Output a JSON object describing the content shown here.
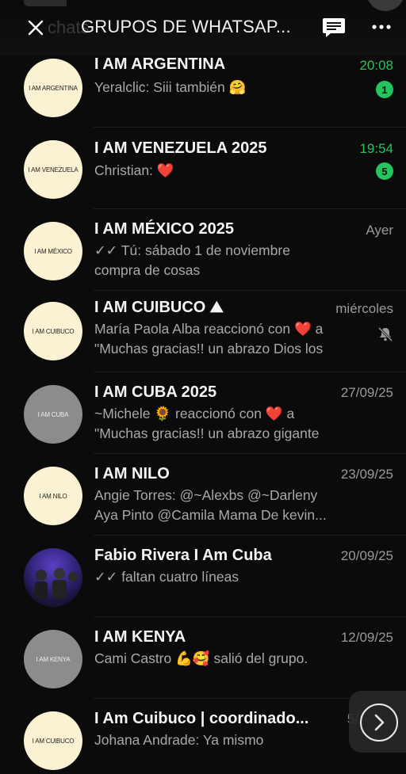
{
  "header": {
    "ghost_title": "chats",
    "title": "GRUPOS DE WHATSAP...",
    "close_icon": "close-icon",
    "compose_icon": "new-chat-icon",
    "more_icon": "more-icon"
  },
  "chats": [
    {
      "name": "I AM ARGENTINA",
      "avatar_text": "I AM ARGENTINA",
      "time": "20:08",
      "time_color": "green",
      "line1": "Yeralclic: Siii también 🤗",
      "line2": "",
      "badge": "1"
    },
    {
      "name": "I AM VENEZUELA 2025",
      "avatar_text": "I AM VENEZUELA",
      "time": "19:54",
      "time_color": "green",
      "line1": "Christian: ❤️",
      "line2": "",
      "badge": "5"
    },
    {
      "name": "I AM MÉXICO 2025",
      "avatar_text": "I AM MÉXICO",
      "time": "Ayer",
      "time_color": "gray",
      "line1": "✓✓ Tú: sábado 1 de noviembre",
      "line2": "compra de cosas",
      "badge": ""
    },
    {
      "name": "I AM CUIBUCO ⛰",
      "avatar_text": "I AM CUIBUCO",
      "time": "miércoles",
      "time_color": "gray",
      "line1": "María Paola Alba reaccionó con ❤️ a",
      "line2": "\"Muchas gracias!! un abrazo Dios los",
      "badge": "",
      "muted": true
    },
    {
      "name": "I AM CUBA 2025",
      "avatar_text": "I AM CUBA",
      "time": "27/09/25",
      "time_color": "gray",
      "line1": "~Michele 🌻 reaccionó con ❤️ a",
      "line2": "\"Muchas gracias!! un abrazo gigante",
      "badge": ""
    },
    {
      "name": "I AM NILO",
      "avatar_text": "I AM NILO",
      "time": "23/09/25",
      "time_color": "gray",
      "line1": "Angie Torres: @~Alexbs @~Darleny",
      "line2": "Aya Pinto @Camila Mama De kevin...",
      "badge": ""
    },
    {
      "name": "Fabio Rivera I Am Cuba",
      "avatar_text": "",
      "time": "20/09/25",
      "time_color": "gray",
      "line1": "✓✓ faltan cuatro líneas",
      "line2": "",
      "badge": ""
    },
    {
      "name": "I AM KENYA",
      "avatar_text": "I AM KENYA",
      "time": "12/09/25",
      "time_color": "gray",
      "line1": "Cami Castro 💪🥰 salió del grupo.",
      "line2": "",
      "badge": ""
    },
    {
      "name": "I Am Cuibuco | coordinado...",
      "avatar_text": "I AM CUIBUCO",
      "time": "5/",
      "time_color": "gray",
      "line1": "Johana Andrade: Ya mismo",
      "line2": "",
      "badge": ""
    }
  ],
  "colors": {
    "background": "#0b0b0b",
    "accent_green": "#22c55e",
    "avatar_cream": "#fbf2d3"
  },
  "next_icon": "chevron-right-icon"
}
